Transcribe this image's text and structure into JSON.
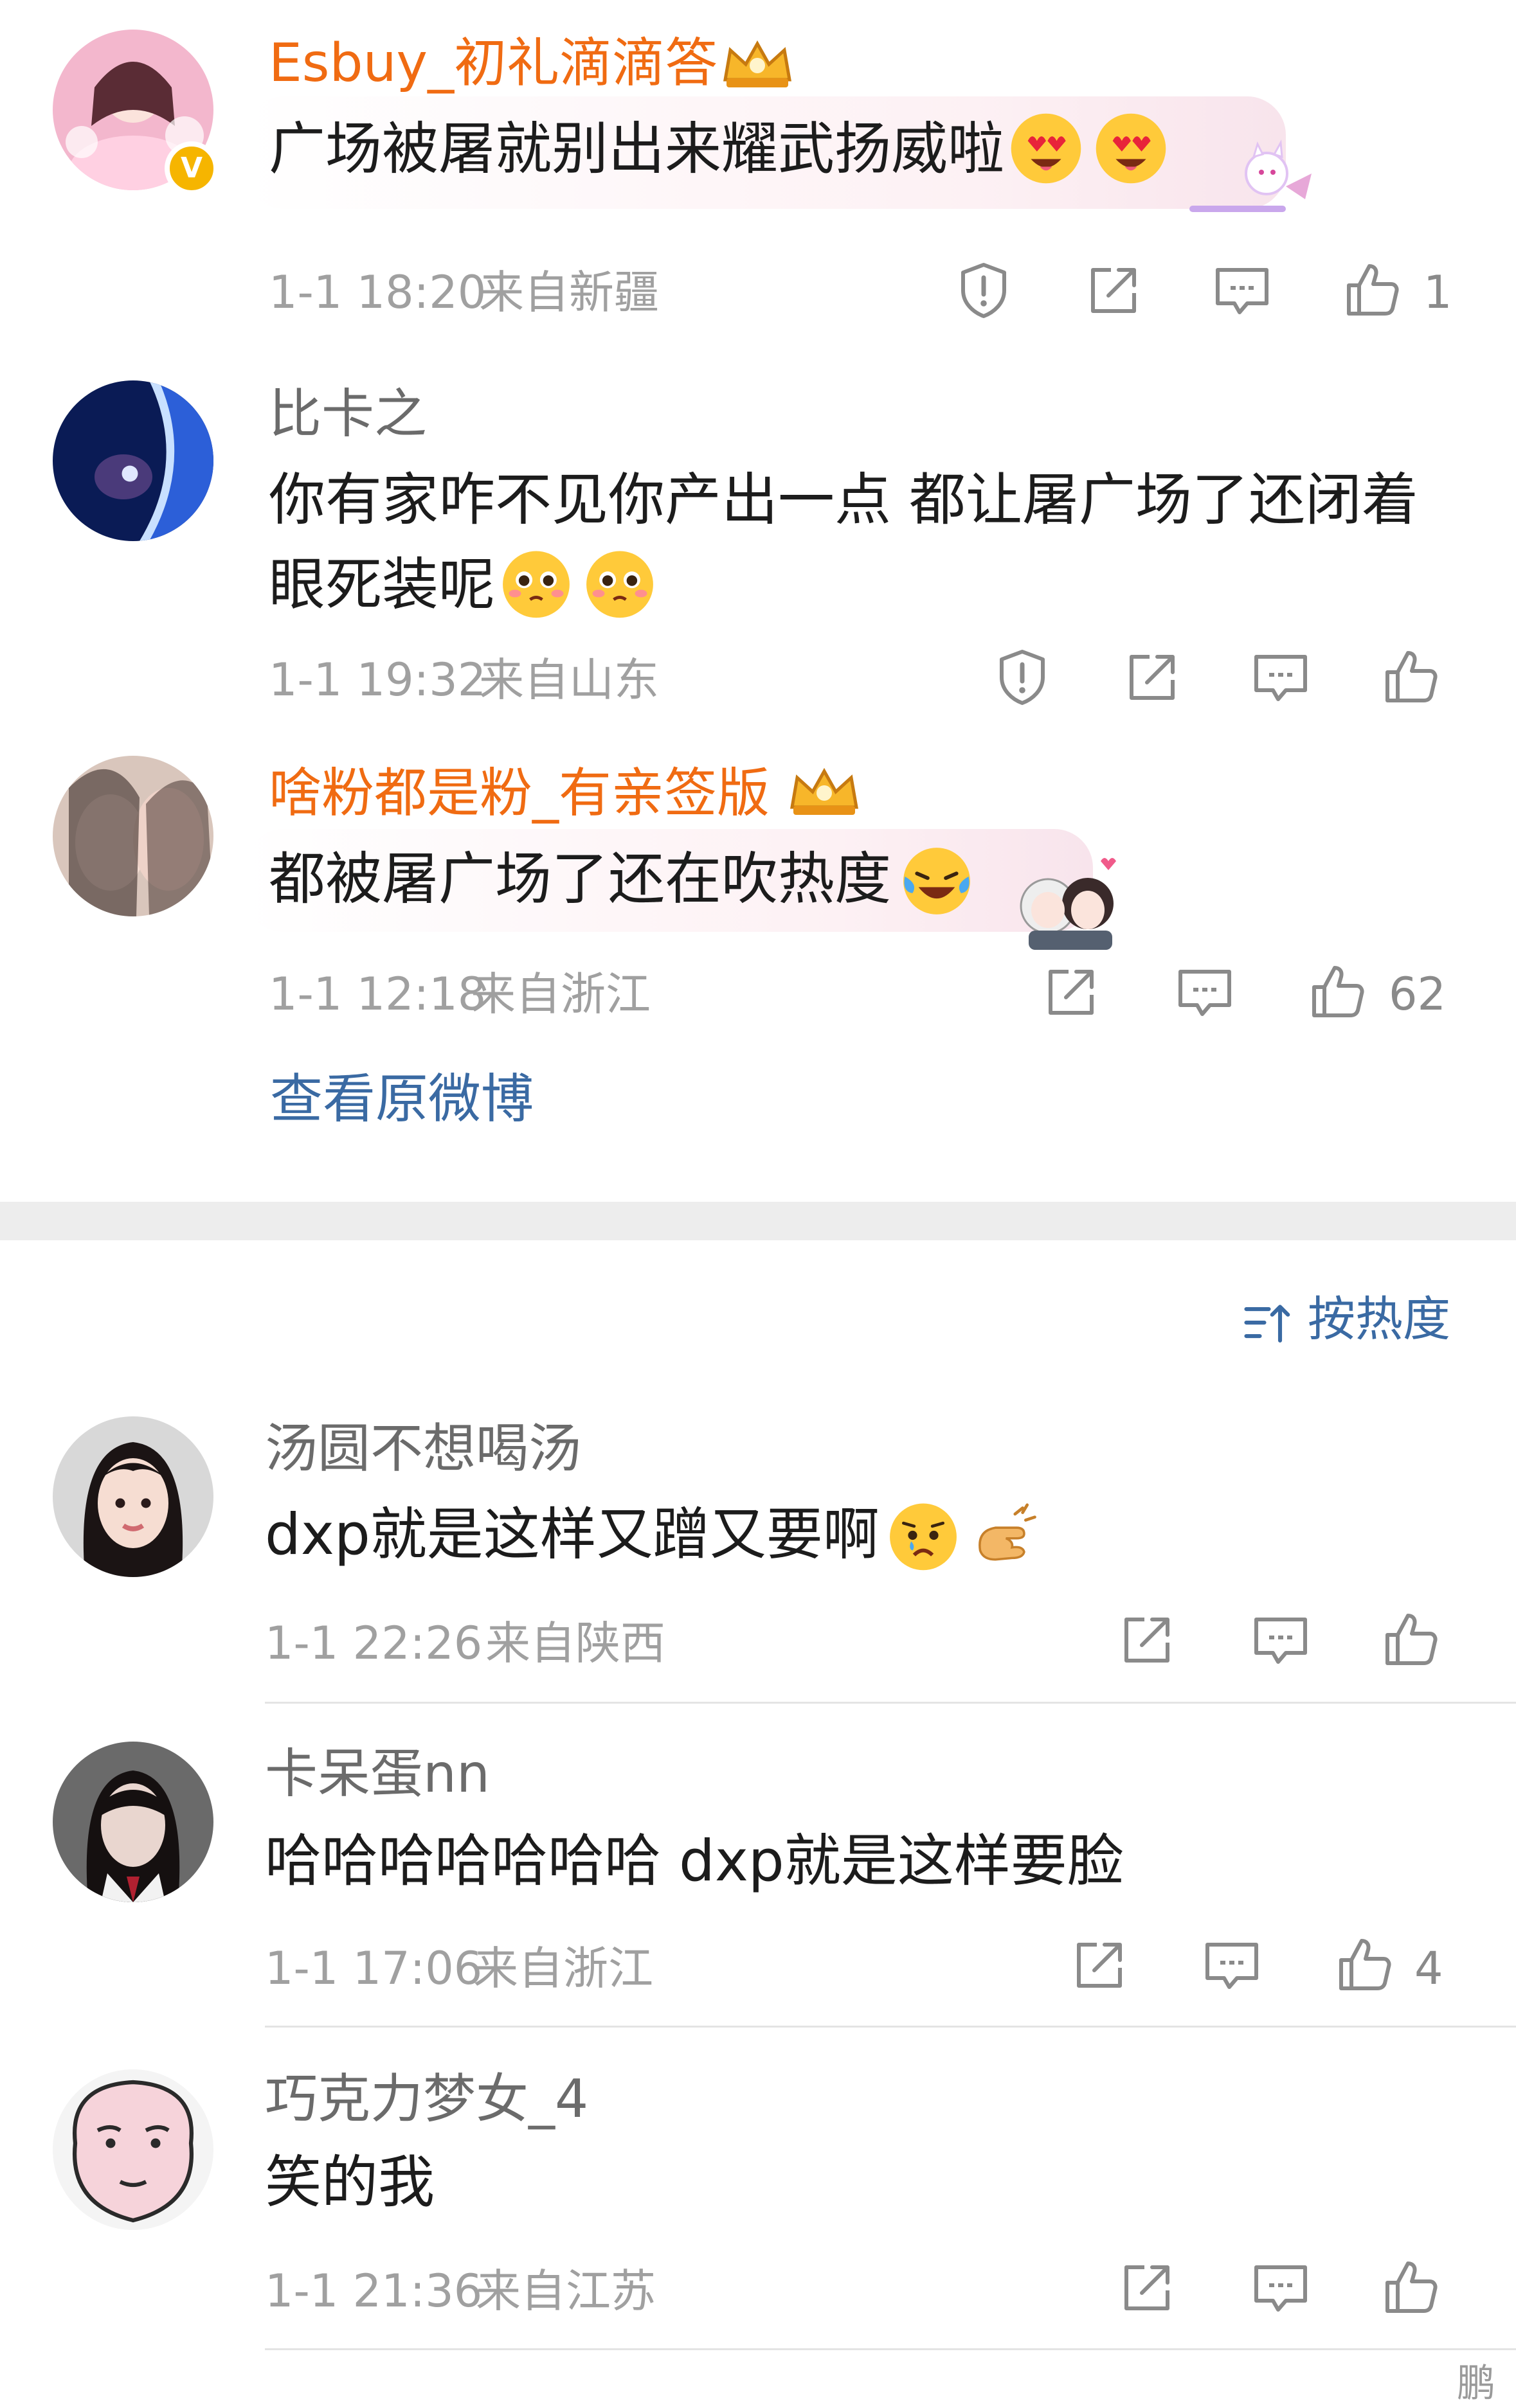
{
  "top_comments": [
    {
      "user": "Esbuy_初礼滴滴答",
      "text": "广场被屠就别出来耀武扬威啦",
      "time": "1-1 18:20",
      "location": "来自新疆",
      "likes": "1"
    },
    {
      "user": "比卡之",
      "text_line1": "你有家咋不见你产出一点 都让屠广场了还闭着",
      "text_line2": "眼死装呢",
      "time": "1-1 19:32",
      "location": "来自山东",
      "likes": ""
    },
    {
      "user": "啥粉都是粉_有亲签版",
      "text": "都被屠广场了还在吹热度",
      "time": "1-1 12:18",
      "location": "来自浙江",
      "likes": "62"
    }
  ],
  "view_original_link": "查看原微博",
  "sort": {
    "label": "按热度",
    "icon": "sort-icon"
  },
  "comments": [
    {
      "user": "汤圆不想喝汤",
      "text": "dxp就是这样又蹭又要啊",
      "time": "1-1 22:26",
      "location": "来自陕西",
      "likes": ""
    },
    {
      "user": "卡呆蛋nn",
      "text": "哈哈哈哈哈哈哈 dxp就是这样要脸",
      "time": "1-1 17:06",
      "location": "来自浙江",
      "likes": "4"
    },
    {
      "user": "巧克力梦女_4",
      "text": "笑的我",
      "time": "1-1 21:36",
      "location": "来自江苏",
      "likes": ""
    }
  ],
  "watermark": "鹏",
  "colors": {
    "vip_name": "#f06b12",
    "link": "#3a6aa3",
    "badge": "#f6b500",
    "divider": "#ededed"
  }
}
